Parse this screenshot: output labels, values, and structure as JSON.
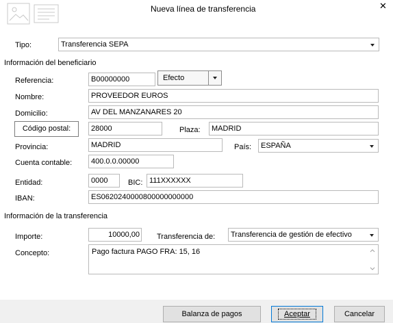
{
  "dialog": {
    "title": "Nueva línea de transferencia",
    "close_glyph": "✕"
  },
  "tipo": {
    "label": "Tipo:",
    "value": "Transferencia SEPA"
  },
  "beneficiario": {
    "section_title": "Información del beneficiario",
    "referencia_label": "Referencia:",
    "referencia_value": "B00000000",
    "efecto_value": "Efecto",
    "nombre_label": "Nombre:",
    "nombre_value": "PROVEEDOR EUROS",
    "domicilio_label": "Domicilio:",
    "domicilio_value": "AV DEL MANZANARES 20",
    "codigo_postal_button": "Código postal:",
    "codigo_postal_value": "28000",
    "plaza_label": "Plaza:",
    "plaza_value": "MADRID",
    "provincia_label": "Provincia:",
    "provincia_value": "MADRID",
    "pais_label": "País:",
    "pais_value": "ESPAÑA",
    "cuenta_label": "Cuenta contable:",
    "cuenta_value": "400.0.0.00000",
    "entidad_label": "Entidad:",
    "entidad_value": "0000",
    "bic_label": "BIC:",
    "bic_value": "111XXXXXX",
    "iban_label": "IBAN:",
    "iban_value": "ES0620240000800000000000"
  },
  "transferencia": {
    "section_title": "Información de la transferencia",
    "importe_label": "Importe:",
    "importe_value": "10000,00",
    "tipo_label": "Transferencia de:",
    "tipo_value": "Transferencia de gestión de efectivo",
    "concepto_label": "Concepto:",
    "concepto_value": "Pago factura PAGO FRA: 15, 16"
  },
  "footer": {
    "balanza_button": "Balanza de pagos",
    "aceptar_button": "Aceptar",
    "cancelar_button": "Cancelar"
  },
  "colors": {
    "background": "#ffffff",
    "border": "#b9b9b9",
    "footer": "#f0f0f0",
    "button": "#e1e1e1"
  }
}
